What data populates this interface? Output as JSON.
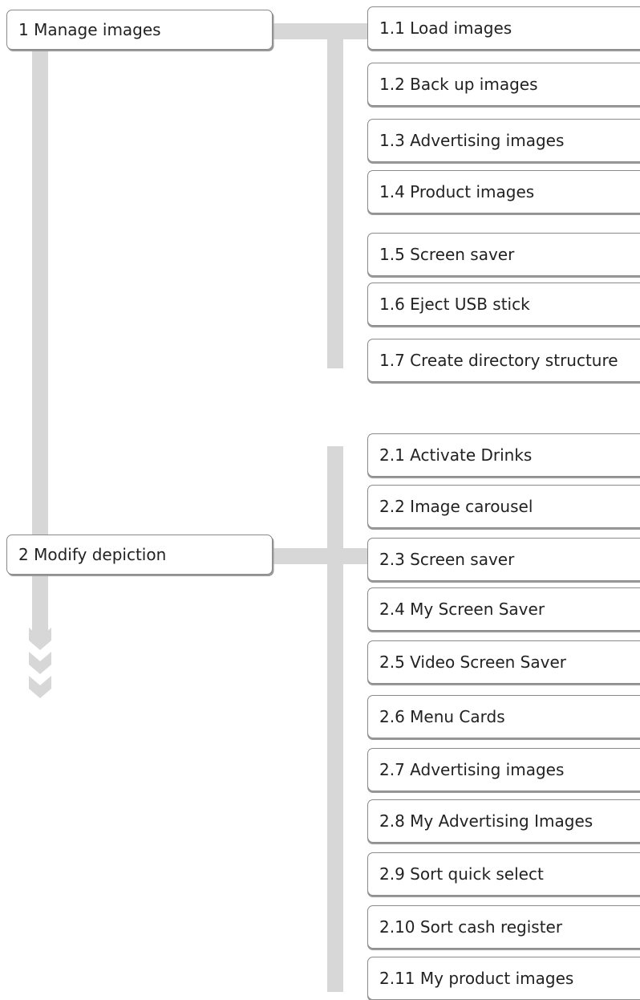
{
  "menu": [
    {
      "label": "1 Manage images",
      "items": [
        "1.1 Load images",
        "1.2 Back up images",
        "1.3 Advertising images",
        "1.4 Product images",
        "1.5 Screen saver",
        "1.6 Eject USB stick",
        "1.7 Create directory structure"
      ]
    },
    {
      "label": "2 Modify depiction",
      "items": [
        "2.1 Activate Drinks",
        "2.2 Image carousel",
        "2.3 Screen saver",
        "2.4 My Screen Saver",
        "2.5 Video Screen Saver",
        "2.6 Menu Cards",
        "2.7 Advertising images",
        "2.8 My Advertising Images",
        "2.9 Sort quick select",
        "2.10 Sort cash register",
        "2.11 My product images"
      ]
    }
  ],
  "colors": {
    "connector": "#d7d7d7",
    "border": "#8a8a8a"
  }
}
